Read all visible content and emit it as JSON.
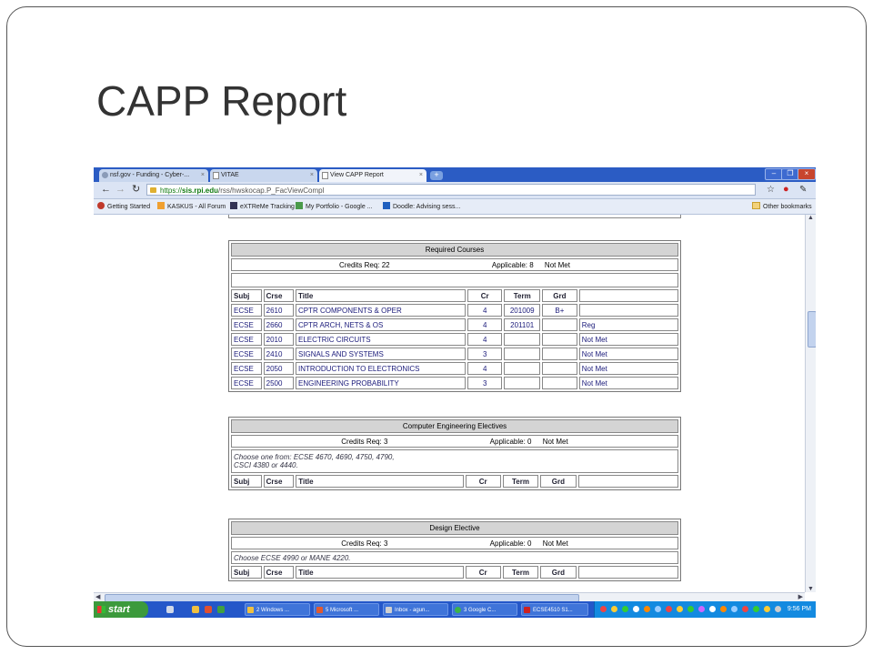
{
  "slide": {
    "title": "CAPP Report"
  },
  "browser": {
    "tabs": [
      {
        "label": "nsf.gov - Funding - Cyber-..."
      },
      {
        "label": "VITAE"
      },
      {
        "label": "View CAPP Report"
      }
    ],
    "url_scheme": "https://",
    "url_host": "sis.rpi.edu",
    "url_path": "/rss/hwskocap.P_FacViewCompl",
    "bookmarks": [
      {
        "label": "Getting Started"
      },
      {
        "label": "KASKUS - All Forum"
      },
      {
        "label": "eXTReMe Tracking"
      },
      {
        "label": "My Portfolio - Google ..."
      },
      {
        "label": "Doodle: Advising sess..."
      }
    ],
    "other_bookmarks": "Other bookmarks"
  },
  "required": {
    "title": "Required Courses",
    "credits_req": "Credits Req: 22",
    "applicable": "Applicable: 8",
    "status": "Not Met",
    "headers": [
      "Subj",
      "Crse",
      "Title",
      "Cr",
      "Term",
      "Grd",
      ""
    ],
    "rows": [
      [
        "ECSE",
        "2610",
        "CPTR COMPONENTS & OPER",
        "4",
        "201009",
        "B+",
        ""
      ],
      [
        "ECSE",
        "2660",
        "CPTR ARCH, NETS & OS",
        "4",
        "201101",
        "",
        "Reg"
      ],
      [
        "ECSE",
        "2010",
        "ELECTRIC CIRCUITS",
        "4",
        "",
        "",
        "Not Met"
      ],
      [
        "ECSE",
        "2410",
        "SIGNALS AND SYSTEMS",
        "3",
        "",
        "",
        "Not Met"
      ],
      [
        "ECSE",
        "2050",
        "INTRODUCTION TO ELECTRONICS",
        "4",
        "",
        "",
        "Not Met"
      ],
      [
        "ECSE",
        "2500",
        "ENGINEERING PROBABILITY",
        "3",
        "",
        "",
        "Not Met"
      ]
    ]
  },
  "electives": {
    "title": "Computer Engineering Electives",
    "credits_req": "Credits Req: 3",
    "applicable": "Applicable: 0",
    "status": "Not Met",
    "note_line1": "Choose one from: ECSE 4670, 4690, 4750, 4790,",
    "note_line2": "CSCI 4380 or 4440.",
    "headers": [
      "Subj",
      "Crse",
      "Title",
      "Cr",
      "Term",
      "Grd",
      ""
    ]
  },
  "design": {
    "title": "Design Elective",
    "credits_req": "Credits Req: 3",
    "applicable": "Applicable: 0",
    "status": "Not Met",
    "note": "Choose ECSE 4990 or MANE 4220.",
    "headers": [
      "Subj",
      "Crse",
      "Title",
      "Cr",
      "Term",
      "Grd",
      ""
    ]
  },
  "taskbar": {
    "start": "start",
    "items": [
      {
        "label": "2 Windows ..."
      },
      {
        "label": "5 Microsoft ..."
      },
      {
        "label": "Inbox - agun..."
      },
      {
        "label": "3 Google C..."
      },
      {
        "label": "ECSE4510 S1..."
      }
    ],
    "clock": "9:56 PM"
  }
}
